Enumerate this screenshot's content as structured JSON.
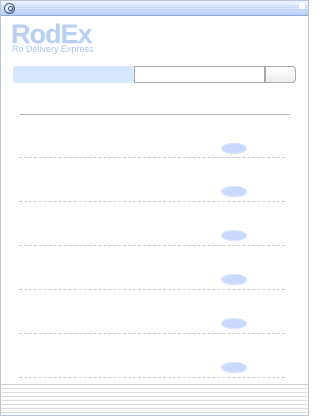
{
  "window": {
    "title": "",
    "icons": {
      "window_button": "circle-button-icon",
      "titlebar_right": "small-square-icon"
    }
  },
  "brand": {
    "logo_text": "RodEx",
    "tagline": "Ro Delivery Express",
    "colors": {
      "logo": "#b9d0f2",
      "accent": "#c9d8ff",
      "titlebar": "#b7cdf6"
    }
  },
  "tracking": {
    "input_value": "",
    "placeholder": "",
    "button_label": ""
  },
  "rows": [
    {
      "button_label": ""
    },
    {
      "button_label": ""
    },
    {
      "button_label": ""
    },
    {
      "button_label": ""
    },
    {
      "button_label": ""
    },
    {
      "button_label": ""
    }
  ]
}
